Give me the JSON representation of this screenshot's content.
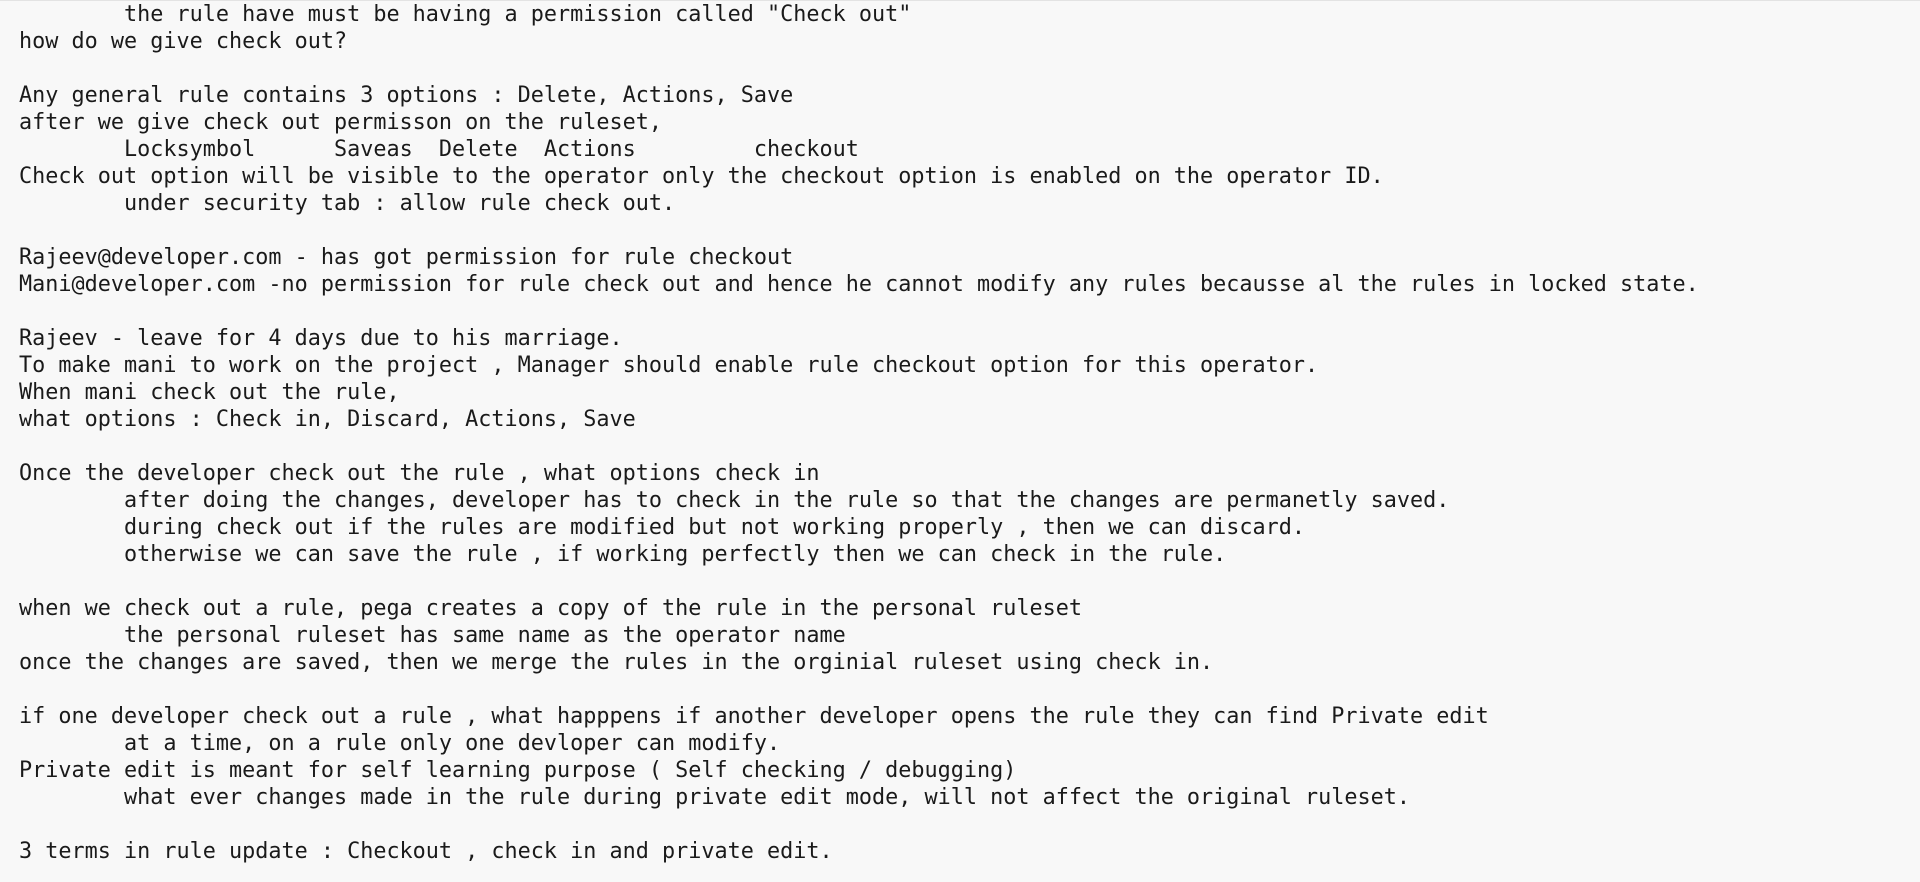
{
  "document": {
    "lines": [
      "\tthe rule have must be having a permission called \"Check out\"",
      "how do we give check out?",
      "",
      "Any general rule contains 3 options : Delete, Actions, Save",
      "after we give check out permisson on the ruleset,",
      "\tLocksymbol      Saveas  Delete  Actions         checkout",
      "Check out option will be visible to the operator only the checkout option is enabled on the operator ID.",
      "\tunder security tab : allow rule check out.",
      "",
      "Rajeev@developer.com - has got permission for rule checkout",
      "Mani@developer.com -no permission for rule check out and hence he cannot modify any rules becausse al the rules in locked state.",
      "",
      "Rajeev - leave for 4 days due to his marriage.",
      "To make mani to work on the project , Manager should enable rule checkout option for this operator.",
      "When mani check out the rule,",
      "what options : Check in, Discard, Actions, Save",
      "",
      "Once the developer check out the rule , what options check in",
      "\tafter doing the changes, developer has to check in the rule so that the changes are permanetly saved.",
      "\tduring check out if the rules are modified but not working properly , then we can discard.",
      "\totherwise we can save the rule , if working perfectly then we can check in the rule.",
      "",
      "when we check out a rule, pega creates a copy of the rule in the personal ruleset",
      "\tthe personal ruleset has same name as the operator name",
      "once the changes are saved, then we merge the rules in the orginial ruleset using check in.",
      "",
      "if one developer check out a rule , what happpens if another developer opens the rule they can find Private edit",
      "\tat a time, on a rule only one devloper can modify.",
      "Private edit is meant for self learning purpose ( Self checking / debugging)",
      "\twhat ever changes made in the rule during private edit mode, will not affect the original ruleset.",
      "",
      "3 terms in rule update : Checkout , check in and private edit."
    ]
  }
}
